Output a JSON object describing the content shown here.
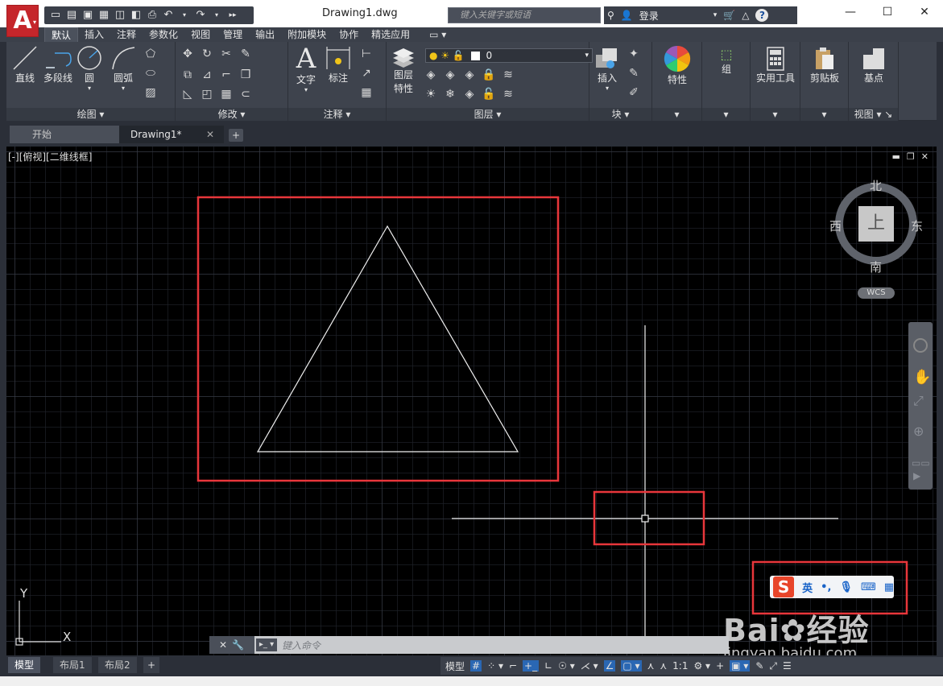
{
  "titlebar": {
    "app_logo": "A",
    "title": "Drawing1.dwg",
    "search_placeholder": "键入关键字或短语",
    "login": "登录",
    "help": "?"
  },
  "ribbon_tabs": [
    "默认",
    "插入",
    "注释",
    "参数化",
    "视图",
    "管理",
    "输出",
    "附加模块",
    "协作",
    "精选应用"
  ],
  "ribbon": {
    "draw": {
      "title": "绘图",
      "line": "直线",
      "polyline": "多段线",
      "circle": "圆",
      "arc": "圆弧"
    },
    "modify": {
      "title": "修改"
    },
    "annotation": {
      "title": "注释",
      "text": "文字",
      "dimension": "标注"
    },
    "layers": {
      "title": "图层",
      "layer_props_1": "图层",
      "layer_props_2": "特性",
      "current_layer": "0"
    },
    "block": {
      "title": "块",
      "insert": "插入"
    },
    "properties": {
      "label": "特性"
    },
    "groups": {
      "label": "组"
    },
    "utilities": {
      "label": "实用工具"
    },
    "clipboard": {
      "label": "剪贴板"
    },
    "view": {
      "title": "视图",
      "basepoint": "基点"
    }
  },
  "file_tabs": {
    "start": "开始",
    "drawing": "Drawing1*"
  },
  "viewport": {
    "label": "[-][俯视][二维线框]",
    "compass": {
      "north": "北",
      "south": "南",
      "east": "东",
      "west": "西",
      "top": "上"
    },
    "wcs": "WCS",
    "ucs_x": "X",
    "ucs_y": "Y"
  },
  "command_line": {
    "placeholder": "键入命令"
  },
  "layout_tabs": [
    "模型",
    "布局1",
    "布局2"
  ],
  "status": {
    "model": "模型",
    "scale": "1:1"
  },
  "ime": {
    "lang": "英"
  },
  "watermark": {
    "brand": "Bai",
    "brand_cn": "经验",
    "url": "jingyan.baidu.com"
  },
  "colors": {
    "accent": "#c5262b",
    "highlight_box": "#e8363b",
    "canvas": "#000000"
  }
}
